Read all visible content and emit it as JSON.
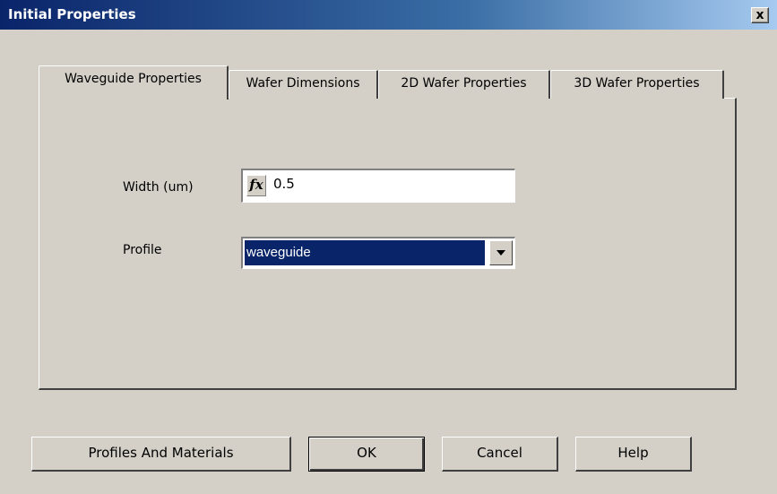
{
  "window": {
    "title": "Initial Properties",
    "close_label": "x"
  },
  "tabs": [
    {
      "label": "Waveguide Properties",
      "active": true
    },
    {
      "label": "Wafer Dimensions",
      "active": false
    },
    {
      "label": "2D Wafer Properties",
      "active": false
    },
    {
      "label": "3D Wafer Properties",
      "active": false
    }
  ],
  "form": {
    "width_label": "Width (um)",
    "width_fx": "fx",
    "width_value": "0.5",
    "profile_label": "Profile",
    "profile_value": "waveguide"
  },
  "buttons": {
    "profiles": "Profiles And Materials",
    "ok": "OK",
    "cancel": "Cancel",
    "help": "Help"
  },
  "colors": {
    "titlebar_start": "#0a246a",
    "titlebar_end": "#a6caf0",
    "face": "#d4d0c8",
    "selection": "#0a246a"
  }
}
